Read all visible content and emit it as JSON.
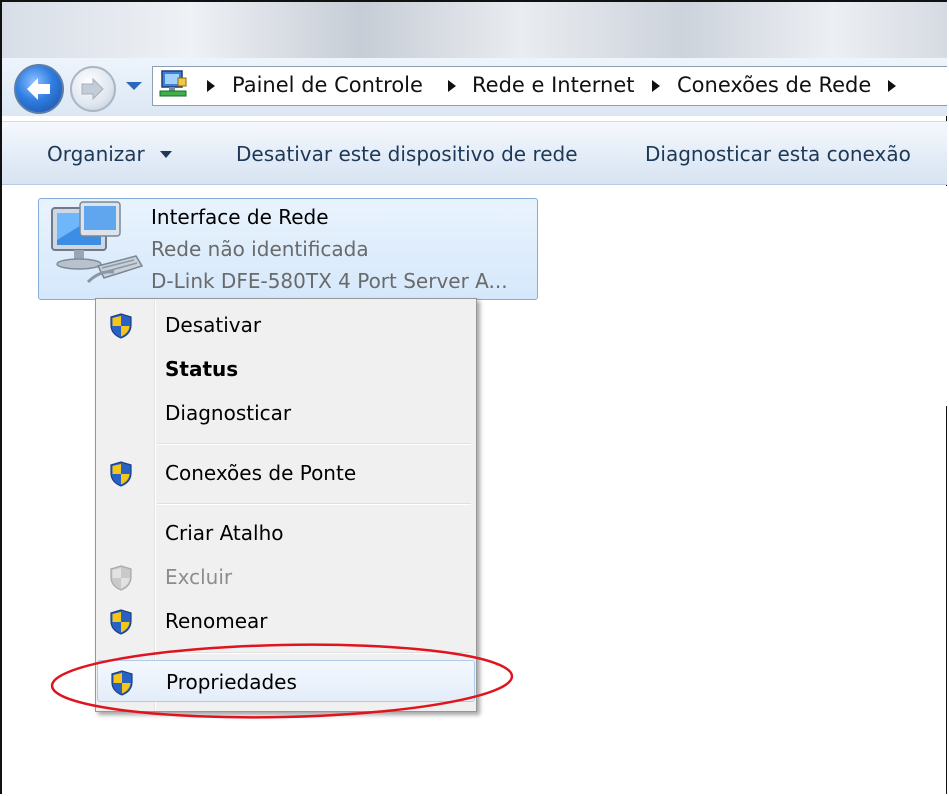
{
  "address": {
    "crumbs": [
      "Painel de Controle",
      "Rede e Internet",
      "Conexões de Rede"
    ]
  },
  "toolbar": {
    "organize_label": "Organizar",
    "disable_label": "Desativar este dispositivo de rede",
    "diagnose_label": "Diagnosticar esta conexão"
  },
  "network_item": {
    "name": "Interface de Rede",
    "status": "Rede não identificada",
    "device": "D-Link DFE-580TX 4 Port Server A..."
  },
  "context_menu": {
    "items": [
      {
        "label": "Desativar",
        "icon": "uac-shield-icon"
      },
      {
        "label": "Status",
        "icon": ""
      },
      {
        "label": "Diagnosticar",
        "icon": ""
      },
      {
        "label": "Conexões de Ponte",
        "icon": "uac-shield-icon"
      },
      {
        "label": "Criar Atalho",
        "icon": ""
      },
      {
        "label": "Excluir",
        "icon": "uac-shield-disabled-icon"
      },
      {
        "label": "Renomear",
        "icon": "uac-shield-icon"
      },
      {
        "label": "Propriedades",
        "icon": "uac-shield-icon"
      }
    ]
  },
  "colors": {
    "highlight_ellipse": "#e0141e",
    "toolbar_text": "#1e3957",
    "selection_border": "#84acdd"
  }
}
